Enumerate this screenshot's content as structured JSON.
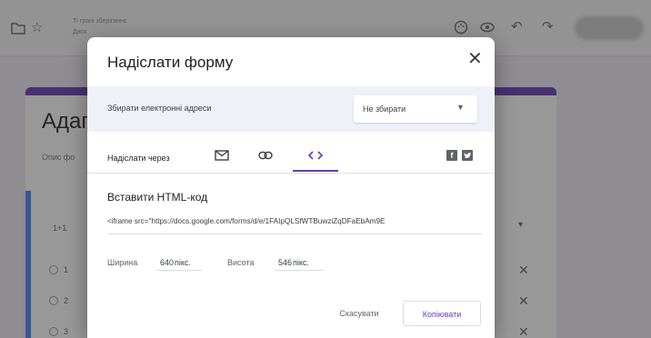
{
  "app": {
    "title_line1": "Ті грані зберіганнє",
    "title_line2": "Диск"
  },
  "background_form": {
    "title": "Адаг",
    "description": "Опис фо",
    "question_label": "1+1",
    "options": [
      "1",
      "2",
      "3"
    ]
  },
  "dialog": {
    "title": "Надіслати форму",
    "close_icon": "close-icon",
    "collect_emails_label": "Збирати електронні адреси",
    "collect_emails_value": "Не збирати",
    "send_via_label": "Надіслати через",
    "send_via_options": [
      "email",
      "link",
      "embed-html"
    ],
    "active_send_via": "embed-html",
    "share_networks": [
      "facebook",
      "twitter"
    ],
    "embed_title": "Вставити HTML-код",
    "embed_code": "<iframe src=\"https://docs.google.com/forms/d/e/1FAIpQLSfWTBuwziZqDFaEbAm9E",
    "width_label": "Ширина",
    "width_value": "640",
    "width_unit": "пікс.",
    "height_label": "Висота",
    "height_value": "546",
    "height_unit": "пікс.",
    "cancel_label": "Скасувати",
    "copy_label": "Копіювати"
  },
  "colors": {
    "accent": "#673ab7",
    "question_bar": "#4285f4",
    "scrim": "#282828"
  }
}
